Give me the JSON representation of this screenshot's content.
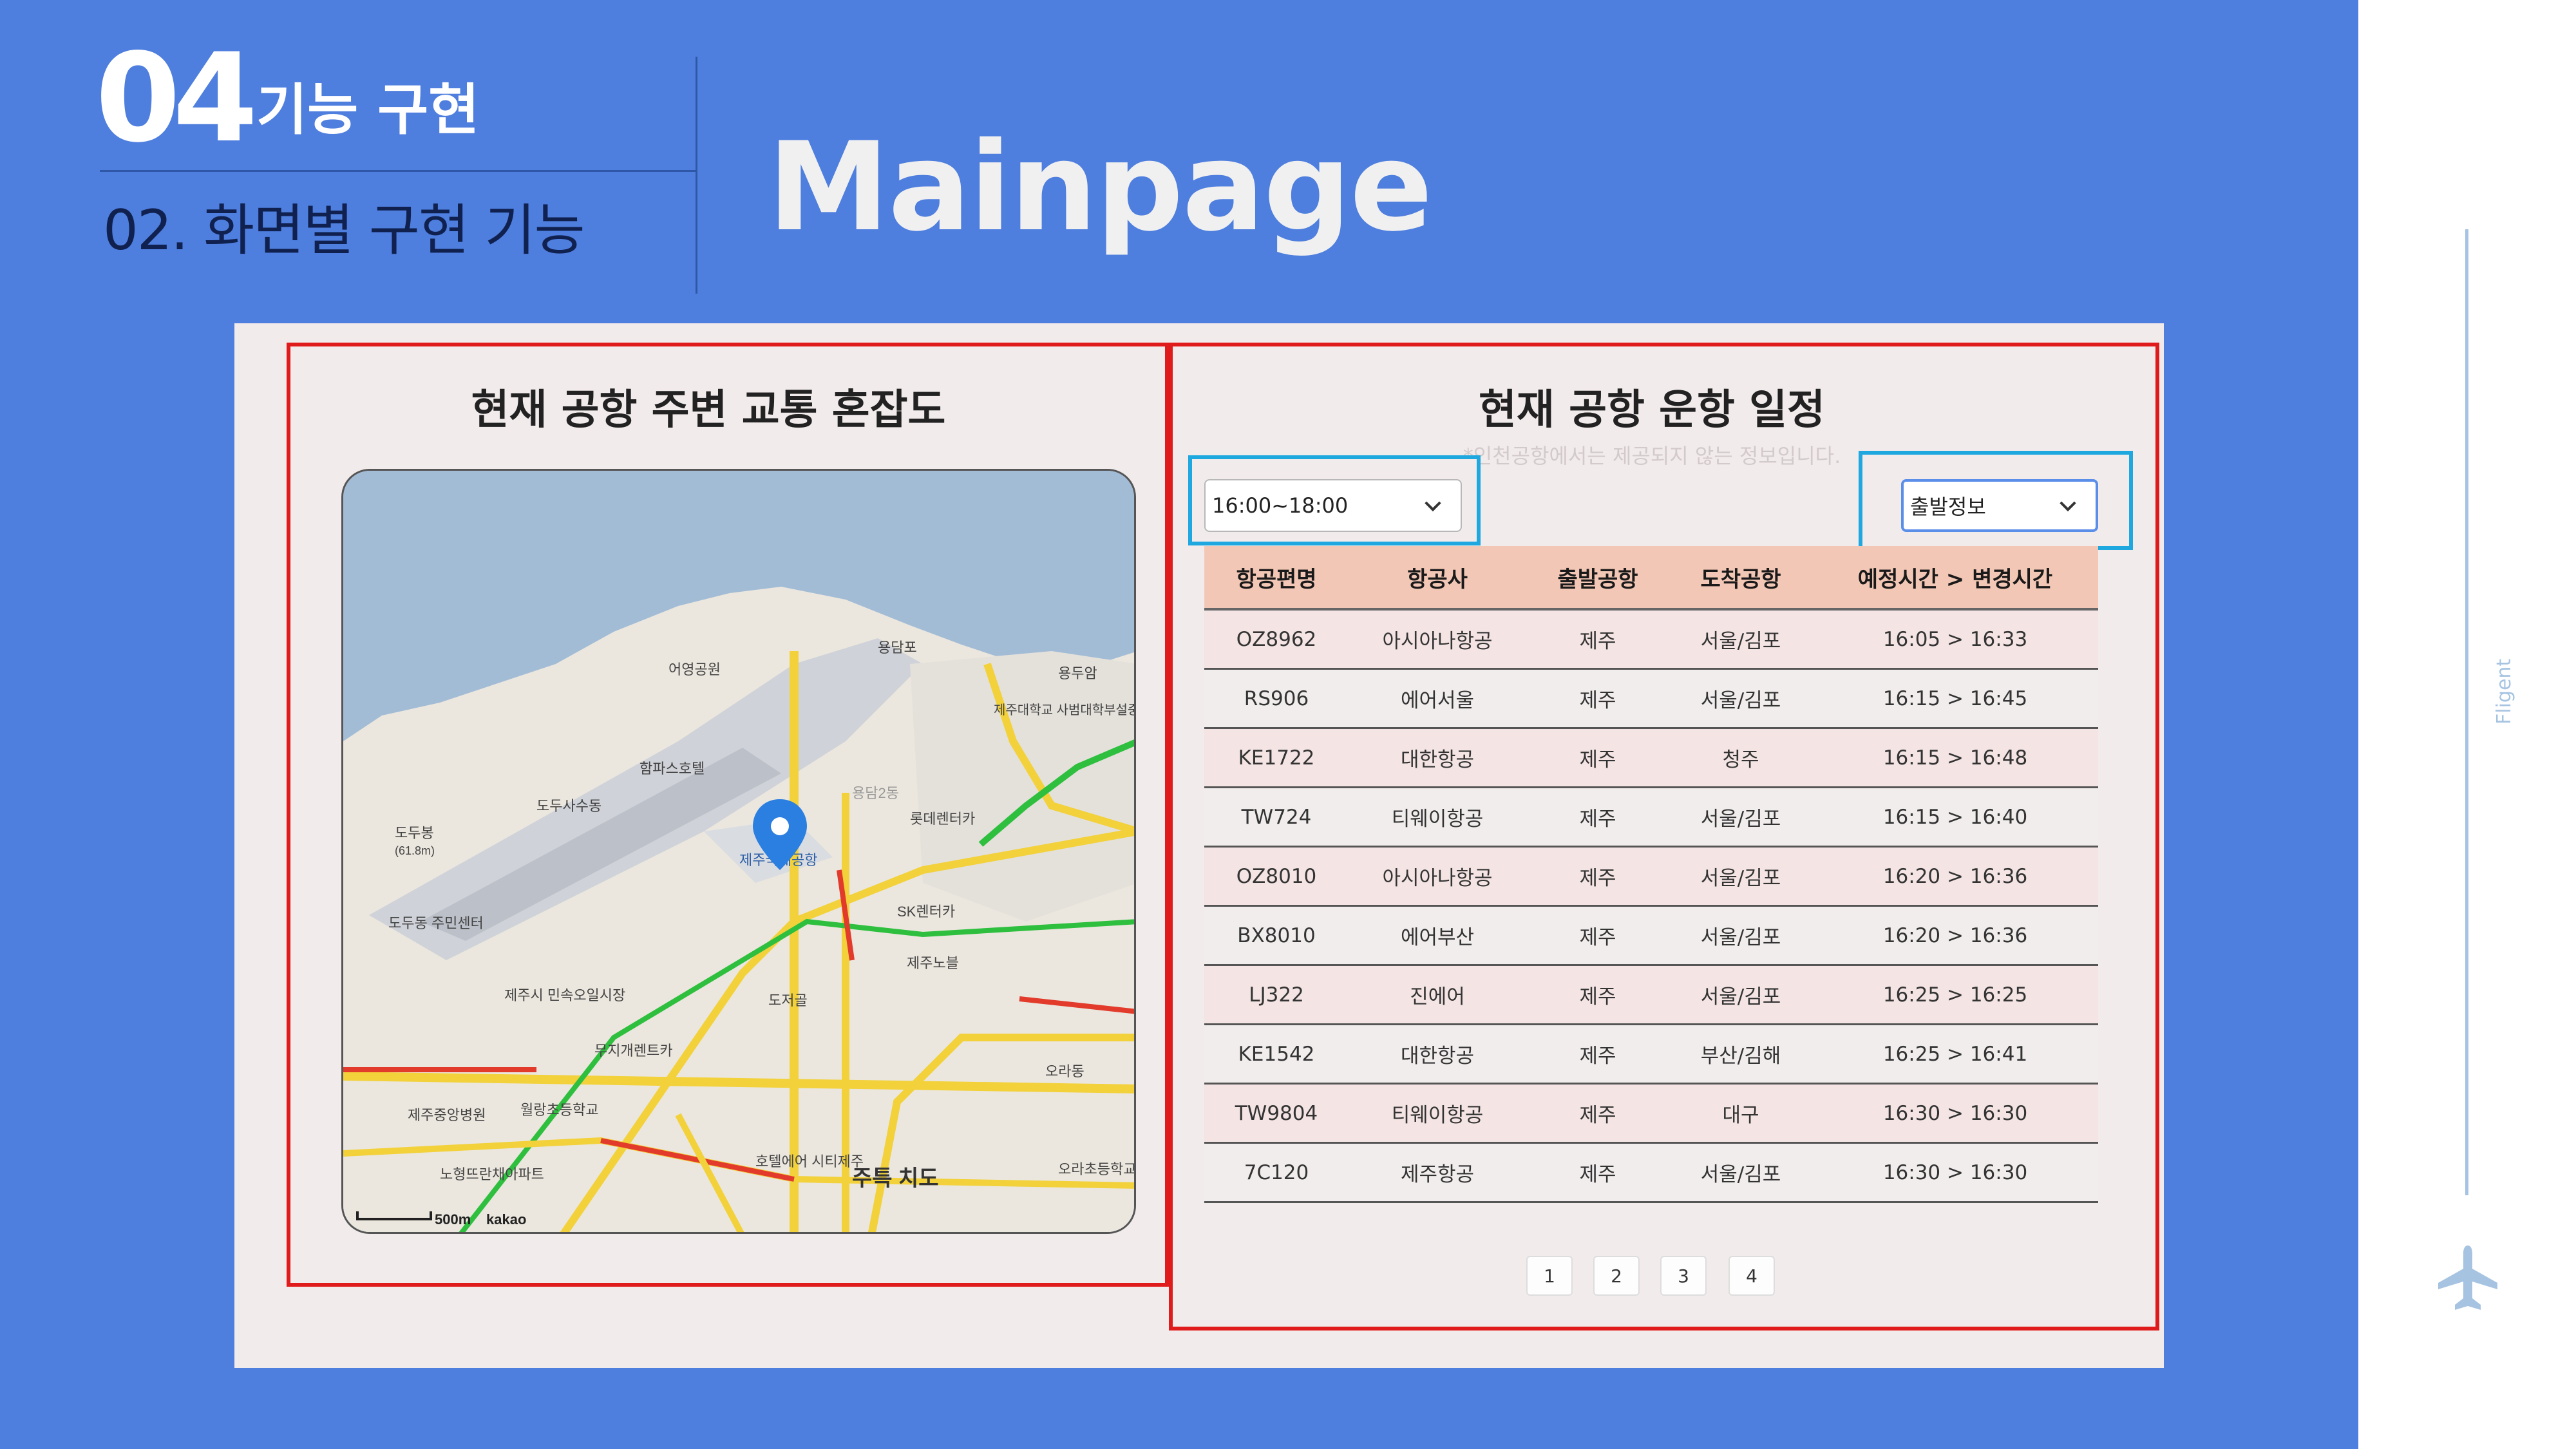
{
  "slide": {
    "section_number": "04",
    "section_title": "기능 구현",
    "subtitle": "02. 화면별 구현 기능",
    "page_title": "Mainpage",
    "brand": "Fligent",
    "plane_icon": "airplane-icon"
  },
  "left_panel": {
    "title": "현재 공항 주변 교통 혼잡도",
    "map": {
      "labels": [
        "어영공원",
        "용담포",
        "용두암",
        "제주대학교 사범대학부설중학교",
        "함파스호텔",
        "도두사수동",
        "도두봉",
        "(61.8m)",
        "제주국제공항",
        "롯데렌터카",
        "용담2동",
        "SK렌터카",
        "제주노블",
        "도두동 주민센터",
        "제주시 민속오일시장",
        "도저골",
        "무지개렌트카",
        "오라동",
        "제주중앙병원",
        "월랑초등학교",
        "오라초등학교",
        "노형뜨란채아파트",
        "호텔에어 시티제주",
        "주특 치도",
        "500m",
        "kakao"
      ],
      "marker_icon": "location-pin-icon"
    }
  },
  "right_panel": {
    "title": "현재 공항 운항 일정",
    "note": "*인천공항에서는 제공되지 않는 정보입니다.",
    "time_select": {
      "value": "16:00~18:00"
    },
    "type_select": {
      "value": "출발정보"
    },
    "table": {
      "headers": [
        "항공편명",
        "항공사",
        "출발공항",
        "도착공항",
        "예정시간 > 변경시간"
      ],
      "rows": [
        [
          "OZ8962",
          "아시아나항공",
          "제주",
          "서울/김포",
          "16:05 > 16:33"
        ],
        [
          "RS906",
          "에어서울",
          "제주",
          "서울/김포",
          "16:15 > 16:45"
        ],
        [
          "KE1722",
          "대한항공",
          "제주",
          "청주",
          "16:15 > 16:48"
        ],
        [
          "TW724",
          "티웨이항공",
          "제주",
          "서울/김포",
          "16:15 > 16:40"
        ],
        [
          "OZ8010",
          "아시아나항공",
          "제주",
          "서울/김포",
          "16:20 > 16:36"
        ],
        [
          "BX8010",
          "에어부산",
          "제주",
          "서울/김포",
          "16:20 > 16:36"
        ],
        [
          "LJ322",
          "진에어",
          "제주",
          "서울/김포",
          "16:25 > 16:25"
        ],
        [
          "KE1542",
          "대한항공",
          "제주",
          "부산/김해",
          "16:25 > 16:41"
        ],
        [
          "TW9804",
          "티웨이항공",
          "제주",
          "대구",
          "16:30 > 16:30"
        ],
        [
          "7C120",
          "제주항공",
          "제주",
          "서울/김포",
          "16:30 > 16:30"
        ]
      ]
    },
    "pagination": [
      "1",
      "2",
      "3",
      "4"
    ]
  },
  "colors": {
    "slide_bg": "#4e7ede",
    "highlight_red": "#e01b1b",
    "highlight_blue": "#1ea8df",
    "table_header": "#f3c7b5"
  }
}
